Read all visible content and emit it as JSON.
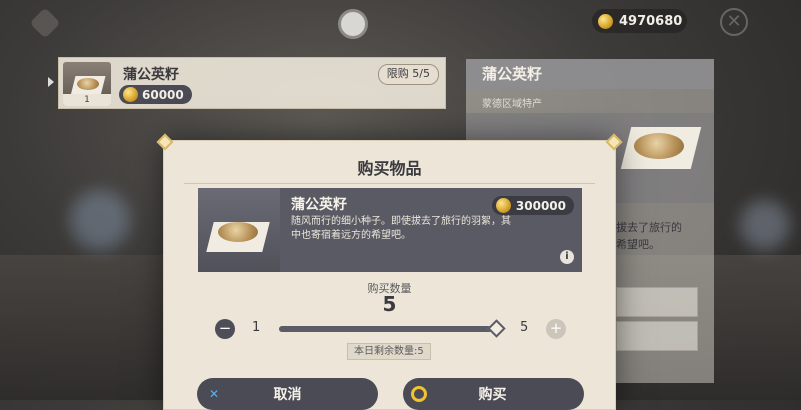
{
  "header": {
    "currency_amount": "4970680",
    "icons": [
      "shop-tag-icon",
      "paimon-menu-icon",
      "primogem-coin-icon",
      "close-icon"
    ]
  },
  "shop_list": {
    "items": [
      {
        "name": "蒲公英籽",
        "price": "60000",
        "quantity": "1",
        "limit": "限购 5/5"
      }
    ]
  },
  "detail_panel": {
    "title": "蒲公英籽",
    "subtitle": "蒙德区域特产",
    "text_line1": "拔去了旅行的",
    "text_line2": "希望吧。"
  },
  "dialog": {
    "title": "购买物品",
    "item": {
      "name": "蒲公英籽",
      "price": "300000",
      "description": "随风而行的细小种子。即使拔去了旅行的羽絮，其中也寄宿着远方的希望吧。"
    },
    "quantity_label": "购买数量",
    "quantity_value": "5",
    "slider": {
      "min": "1",
      "max": "5",
      "fraction": 1.0
    },
    "remaining": "本日剩余数量:5",
    "cancel_label": "取消",
    "confirm_label": "购买"
  },
  "colors": {
    "dialog_bg": "#ece5d8",
    "button_bg": "#4a4b55",
    "coin": "#d4a22a",
    "confirm_ring": "#f2c230"
  }
}
